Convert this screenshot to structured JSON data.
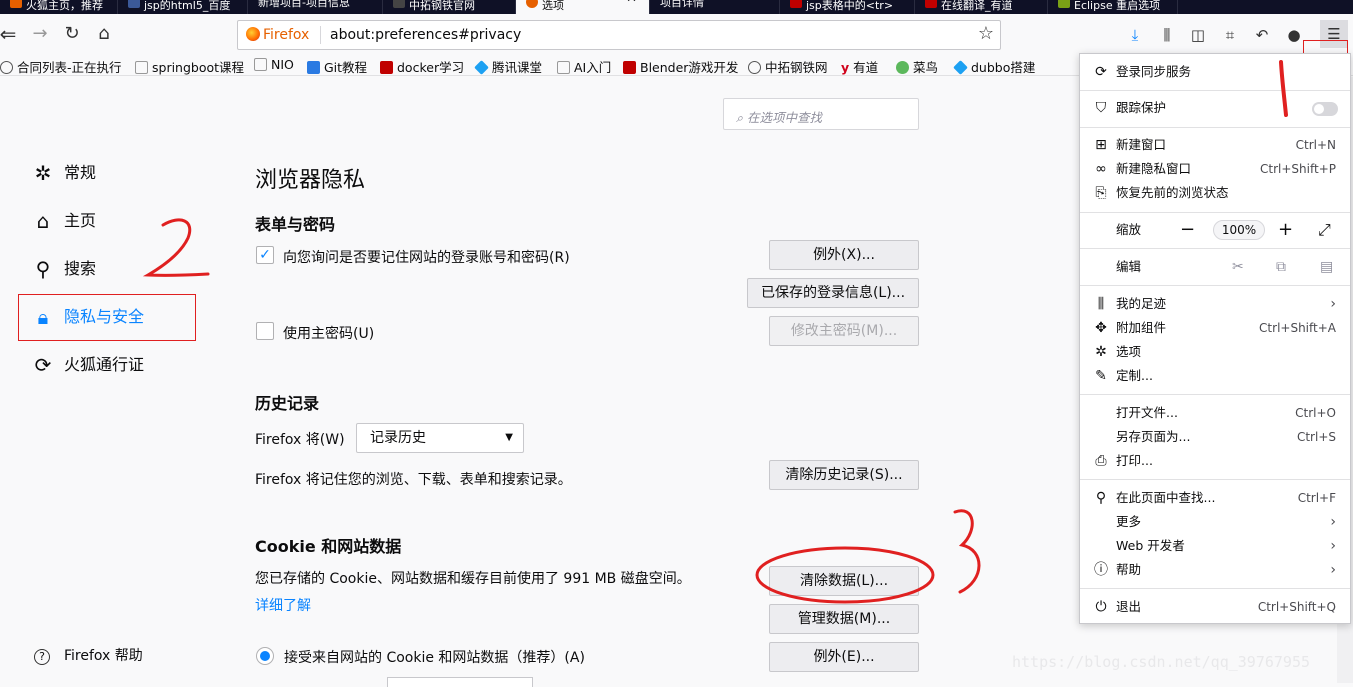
{
  "tabs": [
    {
      "label": "火狐主页，推荐",
      "color": "#e66000"
    },
    {
      "label": "jsp的html5_百度",
      "color": "#3b5998"
    },
    {
      "label": "新增项目-项目信息",
      "color": "#888888"
    },
    {
      "label": "中拓钢铁官网",
      "color": "#444444"
    },
    {
      "label": "选项",
      "color": "#e66000"
    },
    {
      "label": "项目详情",
      "color": "#888888"
    },
    {
      "label": "jsp表格中的<tr>",
      "color": "#c00000"
    },
    {
      "label": "在线翻译_有道",
      "color": "#c00000"
    },
    {
      "label": "Eclipse 重启选项",
      "color": "#7aa116"
    }
  ],
  "urlbar": {
    "identity": "Firefox",
    "url": "about:preferences#privacy"
  },
  "bookmarks": [
    {
      "label": "合同列表-正在执行",
      "icon": "globe-icon",
      "color": "#555555"
    },
    {
      "label": "springboot课程",
      "icon": "page-icon",
      "color": "#999999"
    },
    {
      "label": "NIO",
      "icon": "page-icon",
      "color": "#999999"
    },
    {
      "label": "Git教程",
      "icon": "rocket-icon",
      "color": "#2a7ae2"
    },
    {
      "label": "docker学习",
      "icon": "csdn-icon",
      "color": "#c00000"
    },
    {
      "label": "腾讯课堂",
      "icon": "tencent-icon",
      "color": "#1da1f2"
    },
    {
      "label": "AI入门",
      "icon": "page-icon",
      "color": "#999999"
    },
    {
      "label": "Blender游戏开发",
      "icon": "csdn-icon",
      "color": "#c00000"
    },
    {
      "label": "中拓钢铁网",
      "icon": "globe-icon",
      "color": "#555555"
    },
    {
      "label": "有道",
      "icon": "youdao-icon",
      "color": "#d0021b"
    },
    {
      "label": "菜鸟",
      "icon": "runoob-icon",
      "color": "#5cb85c"
    },
    {
      "label": "dubbo搭建",
      "icon": "tencent-icon",
      "color": "#1da1f2"
    }
  ],
  "search": {
    "placeholder": "在选项中查找"
  },
  "categories": [
    {
      "label": "常规",
      "icon": "gear-icon"
    },
    {
      "label": "主页",
      "icon": "home-icon"
    },
    {
      "label": "搜索",
      "icon": "search-icon"
    },
    {
      "label": "隐私与安全",
      "icon": "lock-icon"
    },
    {
      "label": "火狐通行证",
      "icon": "sync-icon"
    }
  ],
  "help_link": "Firefox 帮助",
  "page": {
    "title": "浏览器隐私",
    "forms": {
      "heading": "表单与密码",
      "remember_logins": "向您询问是否要记住网站的登录账号和密码(R)",
      "exceptions_btn": "例外(X)...",
      "saved_logins_btn": "已保存的登录信息(L)...",
      "master_password": "使用主密码(U)",
      "change_master_btn": "修改主密码(M)..."
    },
    "history": {
      "heading": "历史记录",
      "will_label": "Firefox 将(W)",
      "select_value": "记录历史",
      "desc": "Firefox 将记住您的浏览、下载、表单和搜索记录。",
      "clear_btn": "清除历史记录(S)..."
    },
    "cookies": {
      "heading": "Cookie 和网站数据",
      "desc": "您已存储的 Cookie、网站数据和缓存目前使用了 991 MB 磁盘空间。",
      "learn_more": "详细了解",
      "clear_btn": "清除数据(L)...",
      "manage_btn": "管理数据(M)...",
      "accept": "接受来自网站的 Cookie 和网站数据（推荐）(A)",
      "exceptions_btn": "例外(E)..."
    }
  },
  "menu": {
    "sync": "登录同步服务",
    "tracking": "跟踪保护",
    "new_window": "新建窗口",
    "new_window_sc": "Ctrl+N",
    "new_private": "新建隐私窗口",
    "new_private_sc": "Ctrl+Shift+P",
    "restore": "恢复先前的浏览状态",
    "zoom": "缩放",
    "zoom_value": "100%",
    "edit": "编辑",
    "library": "我的足迹",
    "addons": "附加组件",
    "addons_sc": "Ctrl+Shift+A",
    "options": "选项",
    "customize": "定制...",
    "open_file": "打开文件...",
    "open_file_sc": "Ctrl+O",
    "save_page": "另存页面为...",
    "save_page_sc": "Ctrl+S",
    "print": "打印...",
    "find": "在此页面中查找...",
    "find_sc": "Ctrl+F",
    "more": "更多",
    "webdev": "Web 开发者",
    "help": "帮助",
    "quit": "退出",
    "quit_sc": "Ctrl+Shift+Q"
  },
  "annotations": [
    "1",
    "2",
    "3"
  ],
  "watermark": "https://blog.csdn.net/qq_39767955",
  "colors": {
    "accent": "#0a84ff",
    "annotation": "#e02020",
    "firefox_orange": "#e66000"
  }
}
